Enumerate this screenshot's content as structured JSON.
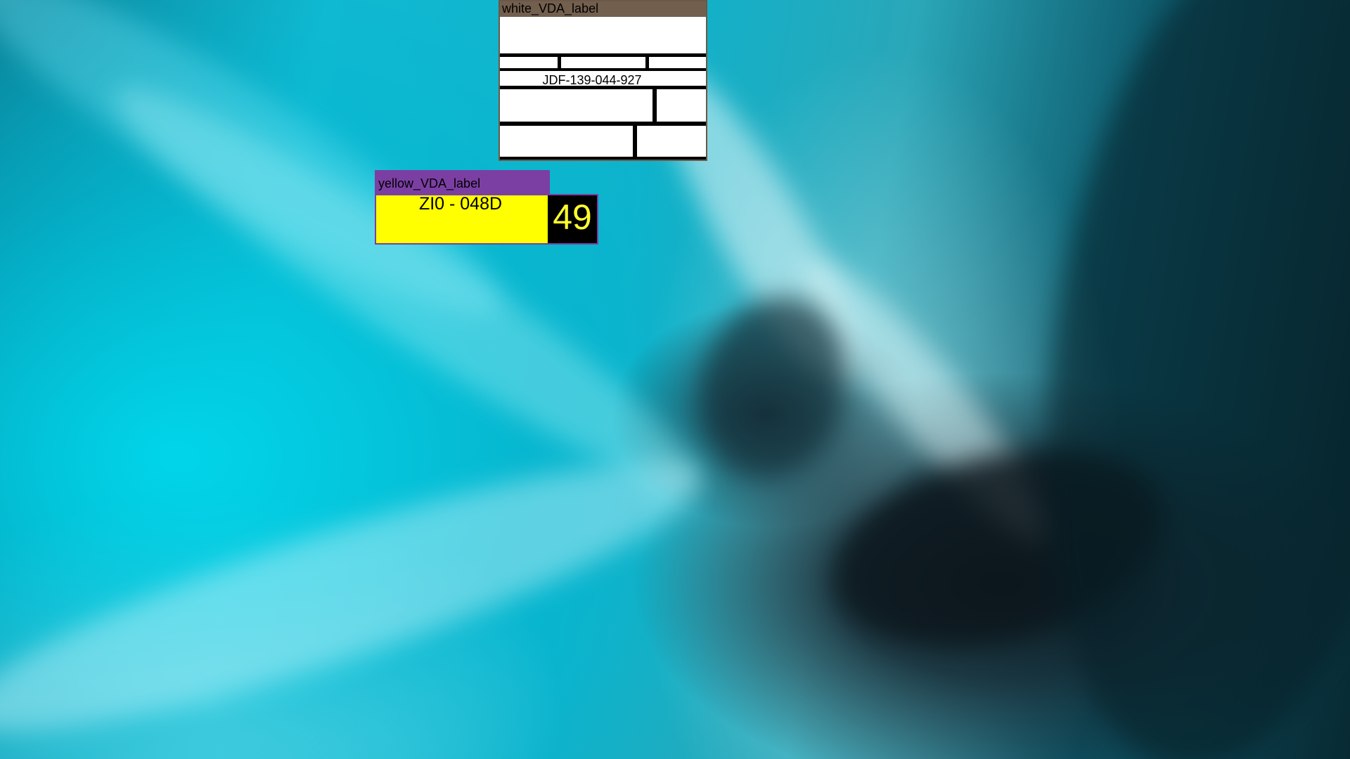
{
  "desktop": {
    "wallpaper": "teal abstract fluid wallpaper"
  },
  "white_vda_label": {
    "title": "white_VDA_label",
    "code": "JDF-139-044-927",
    "title_bar_color": "#735f4e"
  },
  "yellow_vda_label": {
    "title": "yellow_VDA_label",
    "code": "ZI0 - 048D",
    "number": "49",
    "title_bar_color": "#7b3fa3",
    "body_color": "#ffff00"
  }
}
